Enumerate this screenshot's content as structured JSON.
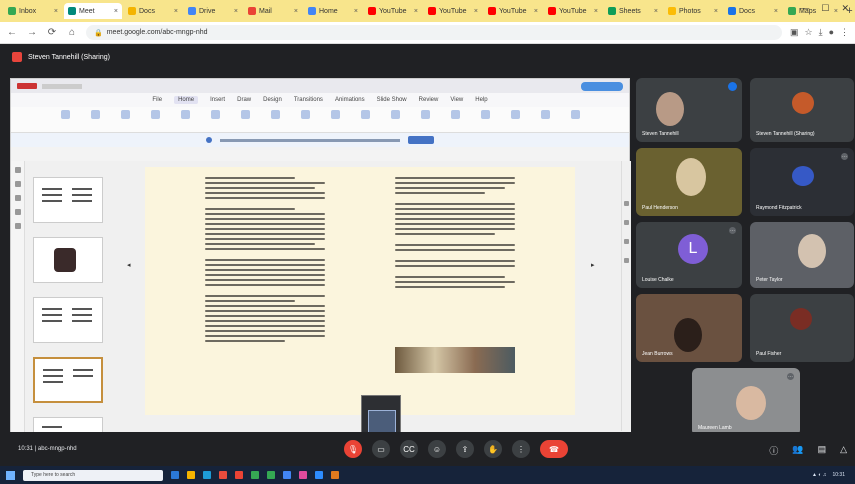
{
  "browser": {
    "tabs": [
      {
        "label": "Inbox",
        "color": "#34a853"
      },
      {
        "label": "Meet",
        "color": "#00897b",
        "active": true
      },
      {
        "label": "Docs",
        "color": "#f4b400"
      },
      {
        "label": "Drive",
        "color": "#4285f4"
      },
      {
        "label": "Mail",
        "color": "#ea4335"
      },
      {
        "label": "Home",
        "color": "#4285f4"
      },
      {
        "label": "YouTube",
        "color": "#ff0000"
      },
      {
        "label": "YouTube",
        "color": "#ff0000"
      },
      {
        "label": "YouTube",
        "color": "#ff0000"
      },
      {
        "label": "YouTube",
        "color": "#ff0000"
      },
      {
        "label": "Sheets",
        "color": "#0f9d58"
      },
      {
        "label": "Photos",
        "color": "#fbbc05"
      },
      {
        "label": "Docs",
        "color": "#1a73e8"
      },
      {
        "label": "Maps",
        "color": "#34a853"
      }
    ],
    "url": "meet.google.com/abc-mngp-nhd"
  },
  "meet": {
    "share_title": "Steven Tannehill (Sharing)",
    "meeting_code": "10:31  |  abc-mngp-nhd",
    "participants": [
      {
        "name": "Steven Tannehill",
        "bg": "#556070"
      },
      {
        "name": "Steven Tannehill (Sharing)",
        "bg": "#2b2d31"
      },
      {
        "name": "Paul Henderson",
        "bg": "#6a6130"
      },
      {
        "name": "Raymond Fitzpatrick",
        "bg": "#2c2f35"
      },
      {
        "name": "Louise Chalke",
        "bg": "#3c4043"
      },
      {
        "name": "Peter Taylor",
        "bg": "#5d6066"
      },
      {
        "name": "Jean Burrows",
        "bg": "#6a5140"
      },
      {
        "name": "Paul Fisher",
        "bg": "#2e3033"
      },
      {
        "name": "Maureen Lamb",
        "bg": "#8c8e90"
      }
    ],
    "avatar_letter": "L"
  },
  "ppt": {
    "menu": [
      "File",
      "Home",
      "Insert",
      "Draw",
      "Design",
      "Transitions",
      "Animations",
      "Slide Show",
      "Review",
      "View",
      "Help"
    ],
    "selected_menu": "Home"
  },
  "taskbar": {
    "search_placeholder": "Type here to search",
    "time": "10:31"
  }
}
